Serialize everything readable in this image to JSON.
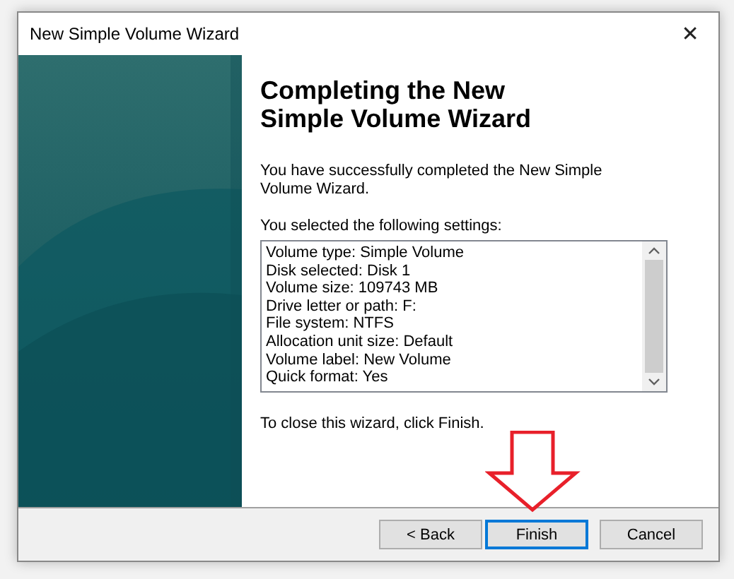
{
  "window": {
    "title": "New Simple Volume Wizard",
    "close": "✕"
  },
  "heading": "Completing the New Simple Volume Wizard",
  "intro": "You have successfully completed the New Simple Volume Wizard.",
  "settings_label": "You selected the following settings:",
  "settings": [
    "Volume type: Simple Volume",
    "Disk selected: Disk 1",
    "Volume size: 109743 MB",
    "Drive letter or path: F:",
    "File system: NTFS",
    "Allocation unit size: Default",
    "Volume label: New Volume",
    "Quick format: Yes"
  ],
  "closing": "To close this wizard, click Finish.",
  "buttons": [
    {
      "label": "< Back",
      "focused": false
    },
    {
      "label": "Finish",
      "focused": true
    },
    {
      "label": "Cancel",
      "focused": false
    }
  ]
}
